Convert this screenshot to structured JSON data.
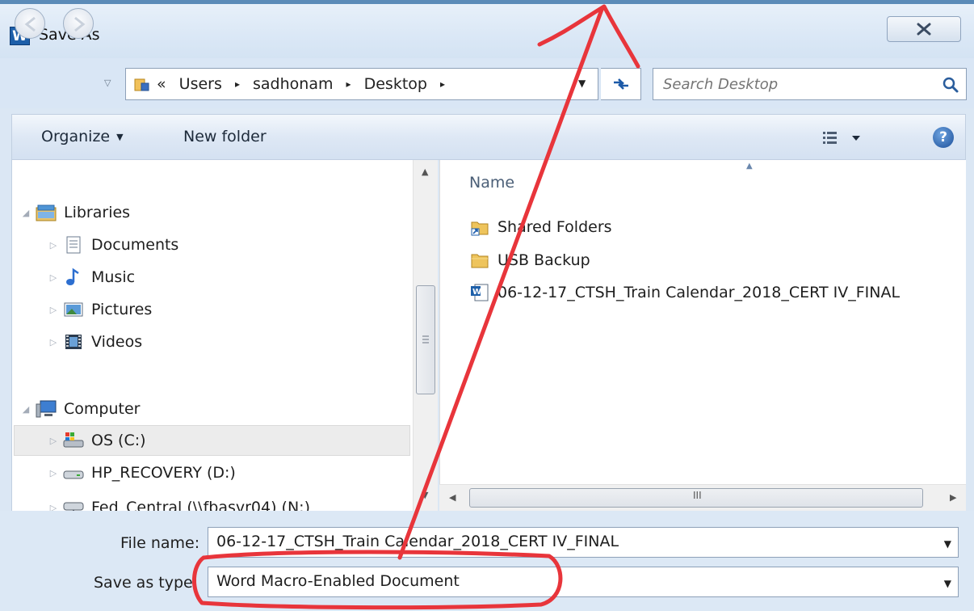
{
  "window": {
    "app_icon_letter": "W",
    "title": "Save As"
  },
  "address": {
    "recent_arrow": "▽",
    "prefix": "«",
    "crumbs": [
      "Users",
      "sadhonam",
      "Desktop"
    ],
    "trail_sep": "▸",
    "dropdown": "▼",
    "refresh_glyph": "↮"
  },
  "search": {
    "placeholder": "Search Desktop"
  },
  "toolbar": {
    "organize": "Organize",
    "organize_arrow": "▼",
    "new_folder": "New folder",
    "help": "?"
  },
  "nav": {
    "items": [
      {
        "label": "Libraries",
        "icon": "libraries-icon",
        "expanded": true
      },
      {
        "label": "Documents",
        "icon": "documents-icon"
      },
      {
        "label": "Music",
        "icon": "music-icon"
      },
      {
        "label": "Pictures",
        "icon": "pictures-icon"
      },
      {
        "label": "Videos",
        "icon": "videos-icon"
      },
      {
        "label": "Computer",
        "icon": "computer-icon",
        "expanded": true
      },
      {
        "label": "OS (C:)",
        "icon": "drive-c-icon",
        "selected": true
      },
      {
        "label": "HP_RECOVERY (D:)",
        "icon": "drive-d-icon"
      },
      {
        "label": "Fed_Central (\\\\fbasvr04) (N:)",
        "icon": "network-drive-icon"
      }
    ]
  },
  "files": {
    "column_name": "Name",
    "rows": [
      {
        "name": "Shared Folders",
        "icon": "shared-folder-icon"
      },
      {
        "name": "USB Backup",
        "icon": "folder-icon"
      },
      {
        "name": "06-12-17_CTSH_Train Calendar_2018_CERT IV_FINAL",
        "icon": "word-doc-icon"
      }
    ],
    "hscroll_grip": "III"
  },
  "form": {
    "file_name_label": "File name:",
    "file_name_value": "06-12-17_CTSH_Train Calendar_2018_CERT IV_FINAL",
    "save_type_label": "Save as type:",
    "save_type_value": "Word Macro-Enabled Document"
  },
  "colors": {
    "annotation": "#e8353b",
    "accent": "#1d5fa9",
    "chrome": "#dbe7f4"
  }
}
